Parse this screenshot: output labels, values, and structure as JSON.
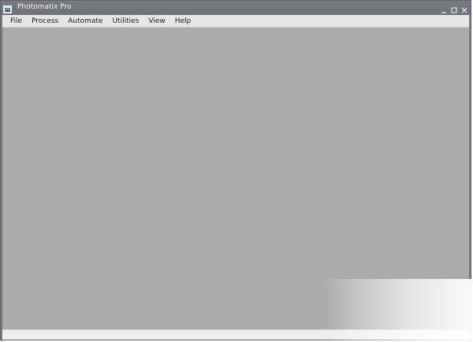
{
  "window": {
    "title": "Photomatix Pro",
    "controls": {
      "minimize_icon": "minimize-icon",
      "maximize_icon": "maximize-icon",
      "close_icon": "close-icon"
    }
  },
  "menu": {
    "items": [
      {
        "label": "File"
      },
      {
        "label": "Process"
      },
      {
        "label": "Automate"
      },
      {
        "label": "Utilities"
      },
      {
        "label": "View"
      },
      {
        "label": "Help"
      }
    ]
  },
  "colors": {
    "titlebar": "#6f7378",
    "menubar": "#e6e6e6",
    "workspace": "#ababab",
    "statusbar": "#eeeeee"
  }
}
